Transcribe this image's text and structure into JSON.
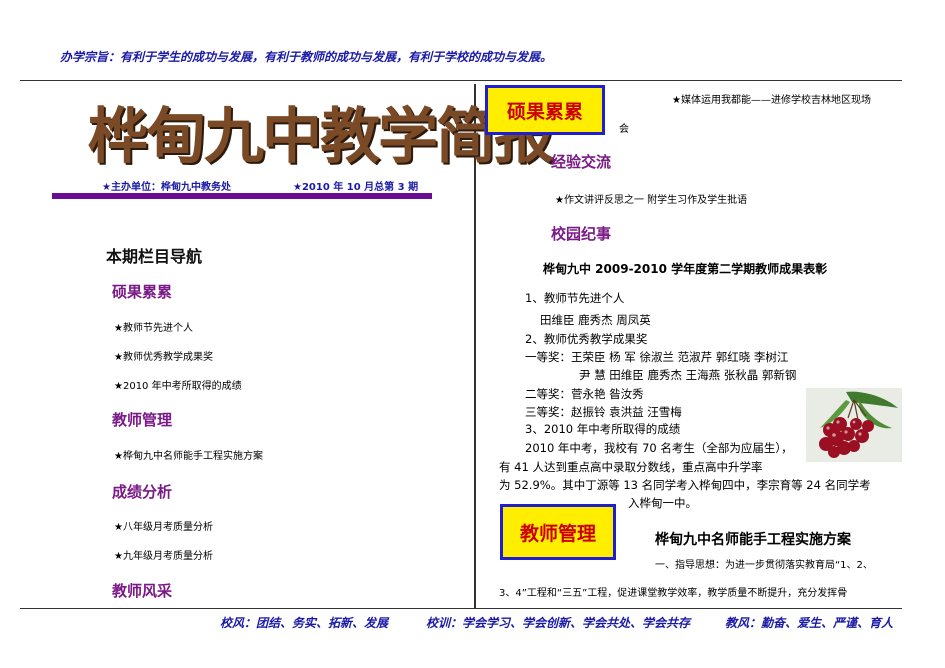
{
  "header": {
    "motto": "办学宗旨：有利于学生的成功与发展，有利于教师的成功与发展，有利于学校的成功与发展。"
  },
  "masthead": {
    "title": "桦甸九中教学简报",
    "publisher": "★主办单位：桦甸九中教务处",
    "issue": "★2010 年 10 月总第 3 期"
  },
  "nav": {
    "title": "本期栏目导航",
    "sections": [
      {
        "name": "硕果累累",
        "items": [
          "★教师节先进个人",
          "★教师优秀教学成果奖",
          "★2010 年中考所取得的成绩"
        ]
      },
      {
        "name": "教师管理",
        "items": [
          "★桦甸九中名师能手工程实施方案"
        ]
      },
      {
        "name": "成绩分析",
        "items": [
          "★八年级月考质量分析",
          "★九年级月考质量分析"
        ]
      },
      {
        "name": "教师风采",
        "items": []
      }
    ]
  },
  "right": {
    "badge1": "硕果累累",
    "media_line1": "★媒体运用我都能——进修学校吉林地区现场",
    "media_line2": "会",
    "sec_exchange": "经验交流",
    "exchange_item": "★作文讲评反思之一      附学生习作及学生批语",
    "sec_campus": "校园纪事",
    "award_title": "桦甸九中 2009-2010 学年度第二学期教师成果表彰",
    "l1": "1、教师节先进个人",
    "l2": "田维臣    鹿秀杰    周凤英",
    "l3": "2、教师优秀教学成果奖",
    "l4": "一等奖：王荣臣    杨    军    徐淑兰    范淑芹    郭红晓    李树江",
    "l5": "尹    慧    田维臣    鹿秀杰    王海燕    张秋晶    郭新钢",
    "l6": "二等奖：菅永艳    昝汝秀",
    "l7": "三等奖：赵振铃    袁洪益    汪雪梅",
    "l8": "3、2010 年中考所取得的成绩",
    "l9": "2010 年中考，我校有 70 名考生（全部为应届生），",
    "l10": "有 41 人达到重点高中录取分数线，重点高中升学率",
    "l11": "为 52.9%。其中丁源等 13 名同学考入桦甸四中，李宗育等 24 名同学考",
    "l12": "入桦甸一中。",
    "badge2": "教师管理",
    "plan_title": "桦甸九中名师能手工程实施方案",
    "plan_l1": "一、指导思想：为进一步贯彻落实教育局“1、2、",
    "plan_l2": "3、4”工程和“三五”工程，促进课堂教学效率，教学质量不断提升，充分发挥骨"
  },
  "footer": {
    "school_style": "校风：团结、务实、拓新、发展",
    "school_motto": "校训：学会学习、学会创新、学会共处、学会共存",
    "teaching_style": "教风：勤奋、爱生、严谨、育人"
  },
  "colors": {
    "accent_blue": "#1a1aa6",
    "section_purple": "#7a1a86",
    "badge_yellow": "#ffee00",
    "badge_red": "#cc0000"
  }
}
